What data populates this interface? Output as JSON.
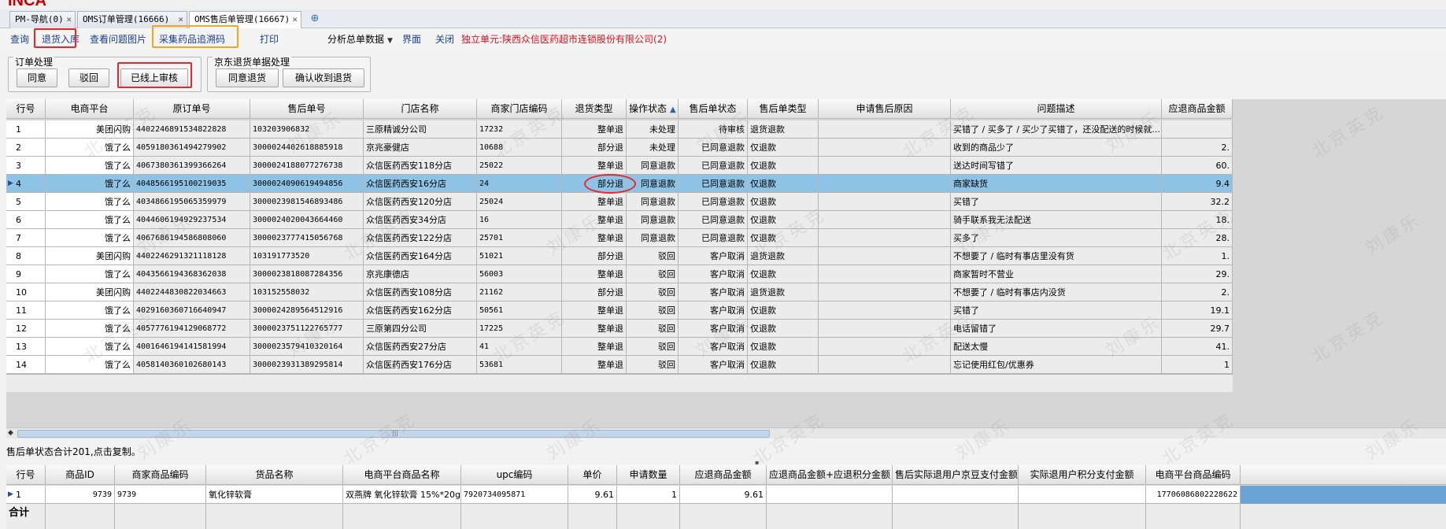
{
  "tabs": [
    {
      "label": "PM-导航(0)",
      "close": "✕"
    },
    {
      "label": "OMS订单管理(16666)",
      "close": "✕"
    },
    {
      "label": "OMS售后单管理(16667)",
      "close": "✕"
    }
  ],
  "tab_add_icon": "plus-circle-icon",
  "toolbar": {
    "query": "查询",
    "return_in": "退货入库",
    "view_images": "查看问题图片",
    "collect_trace": "采集药品追溯码",
    "print": "打印",
    "analysis": "分析总单数据",
    "interface": "界面",
    "close": "关闭",
    "unit": "独立单元:陕西众信医药超市连锁股份有限公司(2)"
  },
  "order_group": {
    "title": "订单处理",
    "agree": "同意",
    "reject": "驳回",
    "reviewed": "已线上审核"
  },
  "jd_group": {
    "title": "京东退货单据处理",
    "agree_return": "同意退货",
    "confirm_receive": "确认收到退货"
  },
  "main_table": {
    "headers": [
      "行号",
      "电商平台",
      "原订单号",
      "售后单号",
      "门店名称",
      "商家门店编码",
      "退货类型",
      "操作状态",
      "售后单状态",
      "售后单类型",
      "申请售后原因",
      "问题描述",
      "应退商品金额"
    ],
    "rows": [
      [
        "1",
        "美团闪购",
        "4402246891534822828",
        "103203906832",
        "三原精诚分公司",
        "17232",
        "整单退",
        "未处理",
        "待审核",
        "退货退款",
        "",
        "买错了 / 买多了 / 买少了买错了，还没配送的时候就...",
        ""
      ],
      [
        "2",
        "饿了么",
        "4059180361494279902",
        "3000024402618885918",
        "京兆豪健店",
        "10688",
        "部分退",
        "未处理",
        "已同意退款",
        "仅退款",
        "",
        "收到的商品少了",
        "2."
      ],
      [
        "3",
        "饿了么",
        "4067380361399366264",
        "3000024188077276738",
        "众信医药西安118分店",
        "25022",
        "整单退",
        "同意退款",
        "已同意退款",
        "仅退款",
        "",
        "送达时间写错了",
        "60."
      ],
      [
        "4",
        "饿了么",
        "4048566195100219035",
        "3000024090619494856",
        "众信医药西安16分店",
        "24",
        "部分退",
        "同意退款",
        "已同意退款",
        "仅退款",
        "",
        "商家缺货",
        "9.4"
      ],
      [
        "5",
        "饿了么",
        "4034866195065359979",
        "3000023981546893486",
        "众信医药西安120分店",
        "25024",
        "整单退",
        "同意退款",
        "已同意退款",
        "仅退款",
        "",
        "买错了",
        "32.2"
      ],
      [
        "6",
        "饿了么",
        "4044606194929237534",
        "3000024020043664460",
        "众信医药西安34分店",
        "16",
        "整单退",
        "同意退款",
        "已同意退款",
        "仅退款",
        "",
        "骑手联系我无法配送",
        "18."
      ],
      [
        "7",
        "饿了么",
        "4067686194586808060",
        "3000023777415056768",
        "众信医药西安122分店",
        "25701",
        "整单退",
        "同意退款",
        "已同意退款",
        "仅退款",
        "",
        "买多了",
        "28."
      ],
      [
        "8",
        "美团闪购",
        "4402246291321118128",
        "103191773520",
        "众信医药西安164分店",
        "51021",
        "部分退",
        "驳回",
        "客户取消",
        "退货退款",
        "",
        "不想要了 / 临时有事店里没有货",
        "1."
      ],
      [
        "9",
        "饿了么",
        "4043566194368362038",
        "3000023818087284356",
        "京兆康德店",
        "56003",
        "整单退",
        "驳回",
        "客户取消",
        "仅退款",
        "",
        "商家暂时不营业",
        "29."
      ],
      [
        "10",
        "美团闪购",
        "4402244830822034663",
        "103152558032",
        "众信医药西安108分店",
        "21162",
        "部分退",
        "驳回",
        "客户取消",
        "退货退款",
        "",
        "不想要了 / 临时有事店内没货",
        "2."
      ],
      [
        "11",
        "饿了么",
        "4029160360716640947",
        "3000024289564512916",
        "众信医药西安162分店",
        "50561",
        "整单退",
        "驳回",
        "客户取消",
        "仅退款",
        "",
        "买错了",
        "19.1"
      ],
      [
        "12",
        "饿了么",
        "4057776194129068772",
        "3000023751122765777",
        "三原第四分公司",
        "17225",
        "整单退",
        "驳回",
        "客户取消",
        "仅退款",
        "",
        "电话留错了",
        "29.7"
      ],
      [
        "13",
        "饿了么",
        "4001646194141581994",
        "3000023579410320164",
        "众信医药西安27分店",
        "41",
        "整单退",
        "驳回",
        "客户取消",
        "仅退款",
        "",
        "配送太慢",
        "41."
      ],
      [
        "14",
        "饿了么",
        "4058140360102680143",
        "3000023931389295814",
        "众信医药西安176分店",
        "53681",
        "整单退",
        "驳回",
        "客户取消",
        "仅退款",
        "",
        "忘记使用红包/优惠券",
        "1"
      ]
    ]
  },
  "summary_text": "售后单状态合计201,点击复制。",
  "detail_table": {
    "headers": [
      "行号",
      "商品ID",
      "商家商品编码",
      "货品名称",
      "电商平台商品名称",
      "upc编码",
      "单价",
      "申请数量",
      "应退商品金额",
      "应退商品金额+应退积分金额",
      "售后实际退用户京豆支付金额",
      "实际退用户积分支付金额",
      "电商平台商品编码"
    ],
    "rows": [
      [
        "1",
        "9739",
        "9739",
        "氧化锌软膏",
        "双燕牌 氧化锌软膏 15%*20g/瓶",
        "7920734095871",
        "9.61",
        "1",
        "9.61",
        "",
        "",
        "",
        "17706086802228622"
      ]
    ],
    "total_label": "合计"
  },
  "watermark": "北京英克 刘康乐"
}
